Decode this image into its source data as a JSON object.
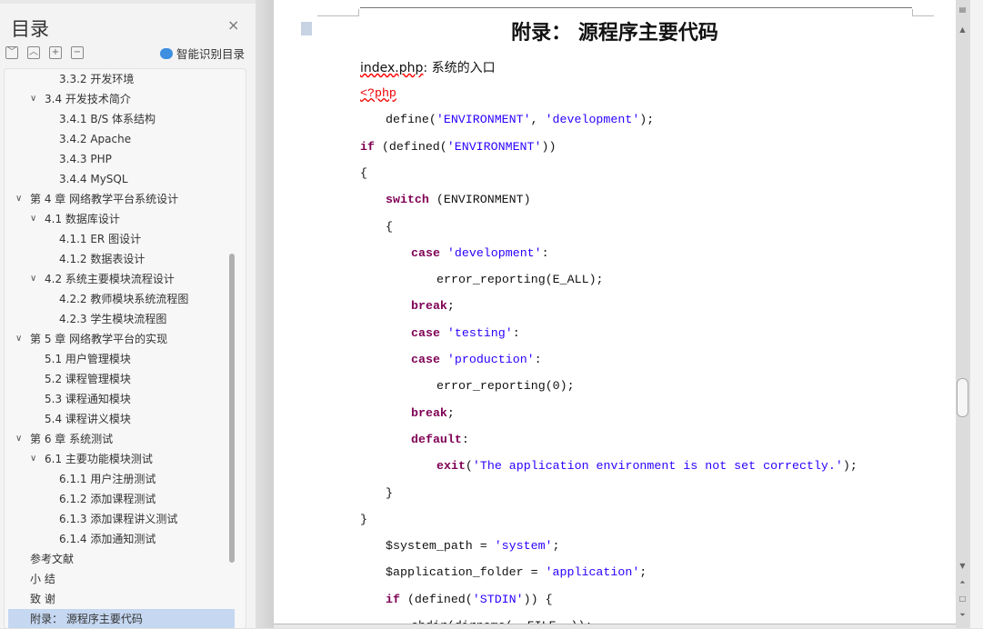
{
  "sidebar": {
    "title": "目录",
    "close": "×",
    "tools": [
      "﹀",
      "︿",
      "+",
      "−"
    ],
    "smart": "智能识别目录",
    "items": [
      {
        "label": "3.3.2 开发环境",
        "level": 3
      },
      {
        "label": "3.4 开发技术简介",
        "level": 2,
        "chev": true
      },
      {
        "label": "3.4.1   B/S 体系结构",
        "level": 3
      },
      {
        "label": "3.4.2   Apache",
        "level": 3
      },
      {
        "label": "3.4.3   PHP",
        "level": 3
      },
      {
        "label": "3.4.4 MySQL",
        "level": 3
      },
      {
        "label": "第 4 章  网络教学平台系统设计",
        "level": 1,
        "chev": true
      },
      {
        "label": "4.1 数据库设计",
        "level": 2,
        "chev": true
      },
      {
        "label": "4.1.1   ER 图设计",
        "level": 3
      },
      {
        "label": "4.1.2   数据表设计",
        "level": 3
      },
      {
        "label": "4.2 系统主要模块流程设计",
        "level": 2,
        "chev": true
      },
      {
        "label": "4.2.2 教师模块系统流程图",
        "level": 3
      },
      {
        "label": "4.2.3 学生模块流程图",
        "level": 3
      },
      {
        "label": "第 5 章  网络教学平台的实现",
        "level": 1,
        "chev": true
      },
      {
        "label": "5.1 用户管理模块",
        "level": 2
      },
      {
        "label": "5.2  课程管理模块",
        "level": 2
      },
      {
        "label": "5.3 课程通知模块",
        "level": 2
      },
      {
        "label": "5.4  课程讲义模块",
        "level": 2
      },
      {
        "label": "第 6 章  系统测试",
        "level": 1,
        "chev": true
      },
      {
        "label": "6.1 主要功能模块测试",
        "level": 2,
        "chev": true
      },
      {
        "label": "6.1.1  用户注册测试",
        "level": 3
      },
      {
        "label": "6.1.2 添加课程测试",
        "level": 3
      },
      {
        "label": "6.1.3 添加课程讲义测试",
        "level": 3
      },
      {
        "label": "6.1.4 添加通知测试",
        "level": 3
      },
      {
        "label": "参考文献",
        "level": 1
      },
      {
        "label": "小   结",
        "level": 1
      },
      {
        "label": "致   谢",
        "level": 1
      },
      {
        "label": "附录：  源程序主要代码",
        "level": 1,
        "selected": true
      }
    ]
  },
  "document": {
    "title": "附录：  源程序主要代码",
    "file_name": "index.php",
    "file_sep": ":   ",
    "file_desc": "系统的入口",
    "code": [
      {
        "i": 0,
        "t": [
          [
            "r",
            "<?php"
          ]
        ]
      },
      {
        "i": 1,
        "t": [
          [
            "p",
            "define("
          ],
          [
            "s",
            "'ENVIRONMENT'"
          ],
          [
            "p",
            ", "
          ],
          [
            "s",
            "'development'"
          ],
          [
            "p",
            ");"
          ]
        ]
      },
      {
        "i": 0,
        "t": [
          [
            "k",
            "if"
          ],
          [
            "p",
            " (defined("
          ],
          [
            "s",
            "'ENVIRONMENT'"
          ],
          [
            "p",
            "))"
          ]
        ]
      },
      {
        "i": 0,
        "t": [
          [
            "p",
            "{"
          ]
        ]
      },
      {
        "i": 1,
        "t": [
          [
            "k",
            "switch"
          ],
          [
            "p",
            " (ENVIRONMENT)"
          ]
        ]
      },
      {
        "i": 1,
        "t": [
          [
            "p",
            "{"
          ]
        ]
      },
      {
        "i": 2,
        "t": [
          [
            "k",
            "case"
          ],
          [
            "p",
            " "
          ],
          [
            "s",
            "'development'"
          ],
          [
            "p",
            ":"
          ]
        ]
      },
      {
        "i": 3,
        "t": [
          [
            "p",
            "error_reporting(E_ALL);"
          ]
        ]
      },
      {
        "i": 2,
        "t": [
          [
            "k",
            "break"
          ],
          [
            "p",
            ";"
          ]
        ]
      },
      {
        "i": 2,
        "t": [
          [
            "k",
            "case"
          ],
          [
            "p",
            " "
          ],
          [
            "s",
            "'testing'"
          ],
          [
            "p",
            ":"
          ]
        ]
      },
      {
        "i": 2,
        "t": [
          [
            "k",
            "case"
          ],
          [
            "p",
            " "
          ],
          [
            "s",
            "'production'"
          ],
          [
            "p",
            ":"
          ]
        ]
      },
      {
        "i": 3,
        "t": [
          [
            "p",
            "error_reporting(0);"
          ]
        ]
      },
      {
        "i": 2,
        "t": [
          [
            "k",
            "break"
          ],
          [
            "p",
            ";"
          ]
        ]
      },
      {
        "i": 2,
        "t": [
          [
            "k",
            "default"
          ],
          [
            "p",
            ":"
          ]
        ]
      },
      {
        "i": 3,
        "t": [
          [
            "k",
            "exit"
          ],
          [
            "p",
            "("
          ],
          [
            "s",
            "'The application environment is not set correctly.'"
          ],
          [
            "p",
            ");"
          ]
        ]
      },
      {
        "i": 1,
        "t": [
          [
            "p",
            "}"
          ]
        ]
      },
      {
        "i": 0,
        "t": [
          [
            "p",
            "}"
          ]
        ]
      },
      {
        "i": 1,
        "t": [
          [
            "p",
            "$system_path = "
          ],
          [
            "s",
            "'system'"
          ],
          [
            "p",
            ";"
          ]
        ]
      },
      {
        "i": 1,
        "t": [
          [
            "p",
            "$application_folder = "
          ],
          [
            "s",
            "'application'"
          ],
          [
            "p",
            ";"
          ]
        ]
      },
      {
        "i": 1,
        "t": [
          [
            "k",
            "if"
          ],
          [
            "p",
            " (defined("
          ],
          [
            "s",
            "'STDIN'"
          ],
          [
            "p",
            ")) {"
          ]
        ]
      },
      {
        "i": 2,
        "t": [
          [
            "p",
            "chdir(dirname(__FILE__));"
          ]
        ]
      }
    ]
  },
  "colors": {
    "keyword": "#7f0055",
    "string": "#2a00ff",
    "selected": "#c5d7f1"
  }
}
